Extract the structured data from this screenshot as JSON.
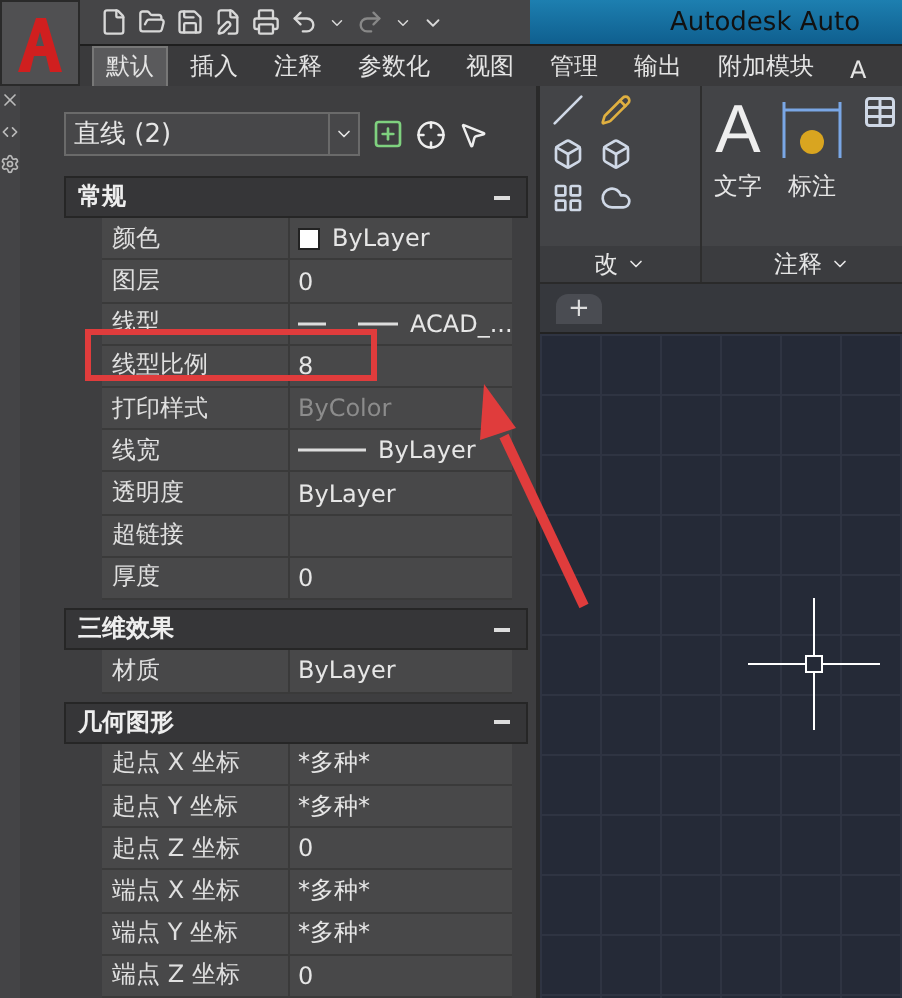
{
  "title_bar": {
    "title": "Autodesk Auto"
  },
  "ribbon_tabs": [
    {
      "label": "默认",
      "selected": true
    },
    {
      "label": "插入",
      "selected": false
    },
    {
      "label": "注释",
      "selected": false
    },
    {
      "label": "参数化",
      "selected": false
    },
    {
      "label": "视图",
      "selected": false
    },
    {
      "label": "管理",
      "selected": false
    },
    {
      "label": "输出",
      "selected": false
    },
    {
      "label": "附加模块",
      "selected": false
    },
    {
      "label": "A",
      "selected": false
    }
  ],
  "ribbon_panels": [
    {
      "title": "改"
    },
    {
      "title": "注释",
      "buttons": [
        {
          "glyph": "A",
          "label": "文字",
          "kind": "text"
        },
        {
          "label": "标注",
          "kind": "dimension"
        }
      ]
    }
  ],
  "drawing_tabs": [
    {
      "label": "+"
    }
  ],
  "properties": {
    "selector": "直线 (2)",
    "sections": [
      {
        "title": "常规",
        "expanded": true,
        "rows": [
          {
            "label": "颜色",
            "value": "ByLayer",
            "kind": "color",
            "disabled": false
          },
          {
            "label": "图层",
            "value": "0",
            "kind": "text",
            "disabled": false
          },
          {
            "label": "线型",
            "value": "ACAD_...",
            "kind": "linetype",
            "disabled": false
          },
          {
            "label": "线型比例",
            "value": "8",
            "kind": "text",
            "disabled": false
          },
          {
            "label": "打印样式",
            "value": "ByColor",
            "kind": "text",
            "disabled": true
          },
          {
            "label": "线宽",
            "value": "ByLayer",
            "kind": "lineweight",
            "disabled": false
          },
          {
            "label": "透明度",
            "value": "ByLayer",
            "kind": "text",
            "disabled": false
          },
          {
            "label": "超链接",
            "kind": "empty"
          },
          {
            "label": "厚度",
            "value": "0",
            "kind": "text",
            "disabled": false
          }
        ]
      },
      {
        "title": "三维效果",
        "expanded": true,
        "rows": [
          {
            "label": "材质",
            "value": "ByLayer",
            "kind": "text",
            "disabled": false
          }
        ]
      },
      {
        "title": "几何图形",
        "expanded": true,
        "rows": [
          {
            "label": "起点 X 坐标",
            "value": "*多种*",
            "kind": "text",
            "disabled": false
          },
          {
            "label": "起点 Y 坐标",
            "value": "*多种*",
            "kind": "text",
            "disabled": false
          },
          {
            "label": "起点 Z 坐标",
            "value": "0",
            "kind": "text",
            "disabled": false
          },
          {
            "label": "端点 X 坐标",
            "value": "*多种*",
            "kind": "text",
            "disabled": false
          },
          {
            "label": "端点 Y 坐标",
            "value": "*多种*",
            "kind": "text",
            "disabled": false
          },
          {
            "label": "端点 Z 坐标",
            "value": "0",
            "kind": "text",
            "disabled": false
          }
        ]
      }
    ]
  }
}
